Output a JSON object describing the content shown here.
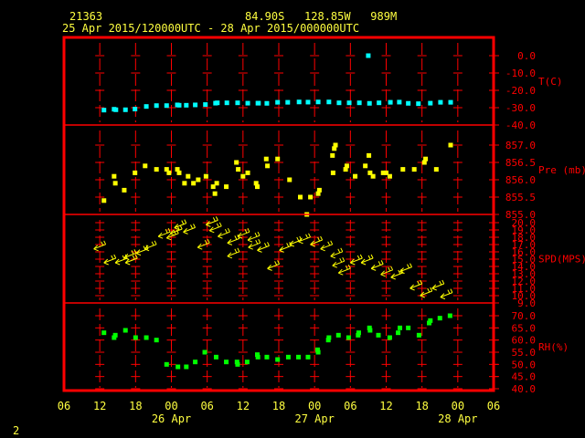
{
  "header": {
    "station": "21363",
    "location": "84.90S   128.85W   989M",
    "period": "25 Apr 2015/120000UTC - 28 Apr 2015/000000UTC"
  },
  "footer": {
    "page": "2"
  },
  "colors": {
    "frame": "#ff0000",
    "text": "#ffff40",
    "temp": "#00ffff",
    "pressure": "#ffff00",
    "wind": "#ffff00",
    "rh": "#00ff00"
  },
  "chart_data": {
    "type": "scatter",
    "x_unit": "hours since 25 Apr 06UTC",
    "xlim": [
      0,
      72
    ],
    "x_ticks": [
      "06",
      "12",
      "18",
      "00",
      "06",
      "12",
      "18",
      "00",
      "06",
      "12",
      "18",
      "00",
      "06"
    ],
    "date_labels": [
      {
        "hour": 18,
        "label": "26 Apr"
      },
      {
        "hour": 42,
        "label": "27 Apr"
      },
      {
        "hour": 66,
        "label": "28 Apr"
      }
    ],
    "panels": [
      {
        "name": "temperature",
        "label": "T(C)",
        "ylim": [
          -40,
          0
        ],
        "ticks": [
          "0.0",
          "-10.0",
          "-20.0",
          "-30.0",
          "-40.0"
        ],
        "tick_values": [
          0,
          -10,
          -20,
          -30,
          -40
        ],
        "marker": "square",
        "color": "#00ffff",
        "points": [
          [
            6.7,
            -31.4
          ],
          [
            8.4,
            -30.9
          ],
          [
            8.7,
            -31.2
          ],
          [
            10.3,
            -31.2
          ],
          [
            11.9,
            -30.8
          ],
          [
            13.8,
            -29.3
          ],
          [
            15.5,
            -28.8
          ],
          [
            17.2,
            -28.8
          ],
          [
            19.0,
            -28.4
          ],
          [
            19.3,
            -28.6
          ],
          [
            20.5,
            -28.6
          ],
          [
            22.0,
            -28.4
          ],
          [
            23.7,
            -28.2
          ],
          [
            25.4,
            -27.4
          ],
          [
            25.7,
            -27.2
          ],
          [
            27.3,
            -27.2
          ],
          [
            29.1,
            -27.2
          ],
          [
            30.8,
            -27.4
          ],
          [
            32.5,
            -27.4
          ],
          [
            32.6,
            -27.4
          ],
          [
            34.0,
            -27.5
          ],
          [
            35.8,
            -26.9
          ],
          [
            37.5,
            -26.9
          ],
          [
            39.4,
            -26.7
          ],
          [
            40.9,
            -26.8
          ],
          [
            42.6,
            -26.7
          ],
          [
            44.4,
            -26.7
          ],
          [
            46.1,
            -27.2
          ],
          [
            47.8,
            -27.2
          ],
          [
            49.5,
            -27.2
          ],
          [
            51.2,
            -27.5
          ],
          [
            52.8,
            -27.2
          ],
          [
            54.7,
            -26.9
          ],
          [
            56.2,
            -26.8
          ],
          [
            57.7,
            -27.5
          ],
          [
            59.4,
            -27.7
          ],
          [
            61.4,
            -27.4
          ],
          [
            63.1,
            -26.9
          ],
          [
            64.8,
            -26.9
          ],
          [
            51.0,
            0.0
          ]
        ]
      },
      {
        "name": "pressure",
        "label": "Pre (mb)",
        "ylim": [
          855.0,
          857.4
        ],
        "ticks": [
          "857.0",
          "856.5",
          "856.0",
          "855.5",
          "855.0"
        ],
        "tick_values": [
          857,
          856.5,
          856,
          855.5,
          855
        ],
        "marker": "square",
        "color": "#ffff00",
        "points": [
          [
            6.7,
            855.4
          ],
          [
            8.4,
            856.1
          ],
          [
            8.6,
            855.9
          ],
          [
            10.1,
            855.7
          ],
          [
            11.9,
            856.2
          ],
          [
            13.6,
            856.4
          ],
          [
            15.5,
            856.3
          ],
          [
            17.2,
            856.3
          ],
          [
            17.6,
            856.2
          ],
          [
            19.0,
            856.3
          ],
          [
            19.3,
            856.2
          ],
          [
            20.2,
            855.9
          ],
          [
            20.8,
            856.1
          ],
          [
            21.7,
            855.9
          ],
          [
            22.5,
            856.0
          ],
          [
            23.8,
            856.1
          ],
          [
            25.0,
            855.8
          ],
          [
            25.3,
            855.6
          ],
          [
            25.6,
            855.9
          ],
          [
            27.2,
            855.8
          ],
          [
            28.9,
            856.5
          ],
          [
            29.2,
            856.3
          ],
          [
            30.0,
            856.1
          ],
          [
            30.8,
            856.2
          ],
          [
            32.2,
            855.9
          ],
          [
            32.4,
            855.8
          ],
          [
            33.9,
            856.6
          ],
          [
            34.1,
            856.4
          ],
          [
            35.8,
            856.6
          ],
          [
            37.8,
            856.0
          ],
          [
            39.6,
            855.5
          ],
          [
            41.3,
            855.5
          ],
          [
            42.6,
            855.6
          ],
          [
            42.8,
            855.7
          ],
          [
            40.7,
            855.0
          ],
          [
            45.0,
            856.7
          ],
          [
            45.3,
            856.9
          ],
          [
            45.5,
            857.0
          ],
          [
            45.1,
            856.2
          ],
          [
            47.2,
            856.3
          ],
          [
            47.4,
            856.4
          ],
          [
            48.8,
            856.1
          ],
          [
            50.5,
            856.4
          ],
          [
            51.1,
            856.7
          ],
          [
            51.3,
            856.2
          ],
          [
            51.8,
            856.1
          ],
          [
            53.5,
            856.2
          ],
          [
            54.0,
            856.2
          ],
          [
            54.6,
            856.1
          ],
          [
            56.8,
            856.3
          ],
          [
            58.7,
            856.3
          ],
          [
            60.4,
            856.5
          ],
          [
            60.6,
            856.6
          ],
          [
            62.4,
            856.3
          ],
          [
            64.8,
            857.0
          ]
        ]
      },
      {
        "name": "wind_speed",
        "label": "SPD(MPS)",
        "ylim": [
          9,
          20
        ],
        "ticks": [
          "20.0",
          "19.0",
          "18.0",
          "17.0",
          "16.0",
          "15.0",
          "14.0",
          "13.0",
          "12.0",
          "11.0",
          "10.0",
          "9.0"
        ],
        "tick_values": [
          20,
          19,
          18,
          17,
          16,
          15,
          14,
          13,
          12,
          11,
          10,
          9
        ],
        "marker": "wind-arrow",
        "color": "#ffff00",
        "points": [
          [
            5.0,
            16.4
          ],
          [
            6.7,
            14.5
          ],
          [
            8.6,
            14.5
          ],
          [
            10.1,
            15.2
          ],
          [
            10.3,
            14.5
          ],
          [
            12.1,
            15.8
          ],
          [
            13.5,
            16.4
          ],
          [
            15.8,
            18.1
          ],
          [
            17.2,
            17.9
          ],
          [
            17.8,
            18.5
          ],
          [
            18.5,
            19.3
          ],
          [
            20.0,
            18.7
          ],
          [
            22.4,
            16.6
          ],
          [
            23.8,
            19.7
          ],
          [
            24.4,
            18.9
          ],
          [
            25.8,
            18.1
          ],
          [
            27.4,
            17.2
          ],
          [
            27.4,
            15.4
          ],
          [
            29.1,
            18.1
          ],
          [
            30.8,
            17.6
          ],
          [
            30.9,
            16.6
          ],
          [
            32.4,
            16.2
          ],
          [
            34.1,
            13.7
          ],
          [
            36.1,
            16.2
          ],
          [
            37.8,
            17.0
          ],
          [
            39.3,
            17.4
          ],
          [
            41.3,
            17.0
          ],
          [
            43.0,
            16.4
          ],
          [
            44.7,
            15.4
          ],
          [
            45.0,
            14.1
          ],
          [
            46.0,
            13.1
          ],
          [
            48.0,
            14.5
          ],
          [
            49.8,
            14.5
          ],
          [
            51.5,
            13.7
          ],
          [
            53.1,
            12.9
          ],
          [
            54.8,
            12.5
          ],
          [
            56.3,
            13.3
          ],
          [
            58.0,
            11.0
          ],
          [
            59.7,
            10.0
          ],
          [
            61.7,
            11.0
          ],
          [
            63.1,
            9.8
          ]
        ]
      },
      {
        "name": "relative_humidity",
        "label": "RH(%)",
        "ylim": [
          40,
          72.5
        ],
        "ticks": [
          "70.0",
          "65.0",
          "60.0",
          "55.0",
          "50.0",
          "45.0",
          "40.0"
        ],
        "tick_values": [
          70,
          65,
          60,
          55,
          50,
          45,
          40
        ],
        "marker": "square",
        "color": "#00ff00",
        "points": [
          [
            6.7,
            63
          ],
          [
            8.4,
            61
          ],
          [
            8.6,
            62
          ],
          [
            10.3,
            64
          ],
          [
            12.0,
            61
          ],
          [
            13.8,
            61
          ],
          [
            15.5,
            60
          ],
          [
            17.2,
            50
          ],
          [
            19.1,
            49
          ],
          [
            20.5,
            49
          ],
          [
            22.0,
            51
          ],
          [
            23.6,
            55
          ],
          [
            25.5,
            53
          ],
          [
            27.2,
            51
          ],
          [
            29.0,
            51
          ],
          [
            29.1,
            50
          ],
          [
            30.7,
            51
          ],
          [
            32.4,
            54
          ],
          [
            32.5,
            53
          ],
          [
            34.0,
            53
          ],
          [
            35.8,
            52
          ],
          [
            37.6,
            53
          ],
          [
            39.3,
            53
          ],
          [
            40.9,
            53
          ],
          [
            42.5,
            56
          ],
          [
            42.6,
            55
          ],
          [
            44.3,
            60
          ],
          [
            44.4,
            61
          ],
          [
            46.0,
            62
          ],
          [
            47.7,
            61
          ],
          [
            49.3,
            62
          ],
          [
            49.4,
            63
          ],
          [
            51.2,
            65
          ],
          [
            51.3,
            64
          ],
          [
            52.7,
            62
          ],
          [
            54.6,
            61
          ],
          [
            56.0,
            63
          ],
          [
            56.3,
            65
          ],
          [
            57.7,
            65
          ],
          [
            59.5,
            62
          ],
          [
            61.2,
            67
          ],
          [
            61.4,
            68
          ],
          [
            63.0,
            69
          ],
          [
            64.7,
            70
          ]
        ]
      }
    ]
  }
}
